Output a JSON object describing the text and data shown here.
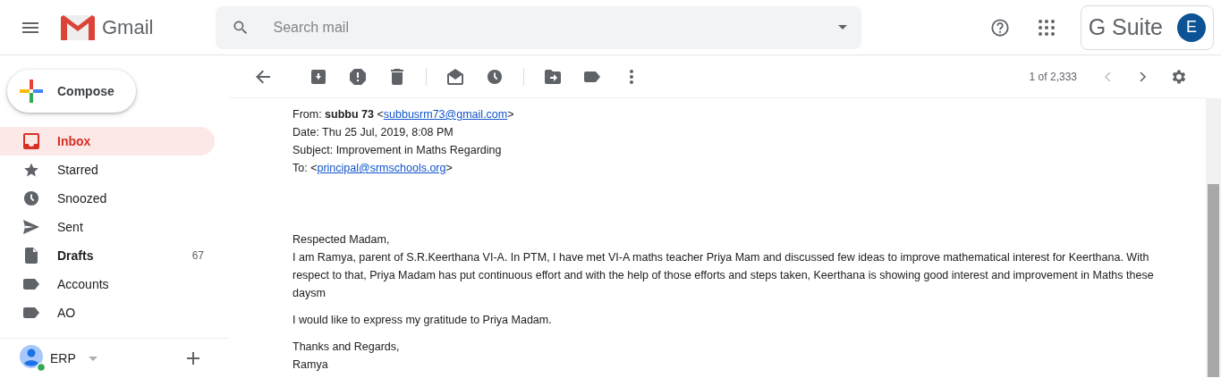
{
  "header": {
    "app_name": "Gmail",
    "search": {
      "placeholder": "Search mail"
    },
    "brand": "G Suite",
    "avatar_letter": "E"
  },
  "compose": {
    "label": "Compose"
  },
  "sidebar": {
    "items": [
      {
        "label": "Inbox",
        "kind": "inbox",
        "selected": true,
        "bold": true
      },
      {
        "label": "Starred",
        "kind": "star",
        "selected": false,
        "bold": false
      },
      {
        "label": "Snoozed",
        "kind": "clock",
        "selected": false,
        "bold": false
      },
      {
        "label": "Sent",
        "kind": "send",
        "selected": false,
        "bold": false
      },
      {
        "label": "Drafts",
        "kind": "file",
        "selected": false,
        "bold": true,
        "count": "67"
      },
      {
        "label": "Accounts",
        "kind": "label",
        "selected": false,
        "bold": false
      },
      {
        "label": "AO",
        "kind": "label",
        "selected": false,
        "bold": false
      }
    ],
    "account": {
      "name": "ERP",
      "online": true
    }
  },
  "toolbar": {
    "pager": "1 of 2,333"
  },
  "message": {
    "headers": [
      {
        "label": "From: ",
        "name": "subbu 73",
        "before_email": "<",
        "email": "subbusrm73@gmail.com",
        "after_email": ">"
      },
      {
        "label": "Date: Thu 25 Jul, 2019, 8:08 PM"
      },
      {
        "label": "Subject: Improvement in Maths Regarding"
      },
      {
        "label": "To: ",
        "before_email": "<",
        "email": "principal@srmschools.org",
        "after_email": ">"
      }
    ],
    "body": [
      {
        "lines": [
          "Respected Madam,",
          "I am Ramya, parent of S.R.Keerthana VI-A. In PTM, I have met VI-A maths teacher Priya Mam and discussed few ideas to improve mathematical interest for Keerthana. With respect to that, Priya Madam has put continuous effort and with the help of those efforts and steps taken, Keerthana is showing good interest and improvement in Maths these daysm"
        ]
      },
      {
        "lines": [
          "I would like to express my gratitude to Priya Madam."
        ]
      },
      {
        "lines": [
          "Thanks and Regards,",
          "Ramya"
        ]
      }
    ]
  }
}
